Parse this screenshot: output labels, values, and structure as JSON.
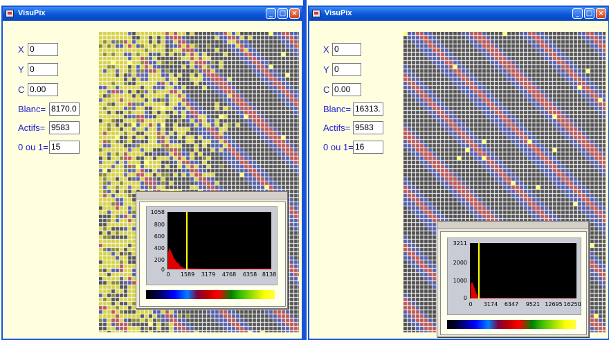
{
  "windows": [
    {
      "title": "VisuPix",
      "fields": [
        {
          "label": "X",
          "value": "0"
        },
        {
          "label": "Y",
          "value": "0"
        },
        {
          "label": "C",
          "value": "0.00"
        },
        {
          "label": "Blanc=",
          "value": "8170.0"
        },
        {
          "label": "Actifs=",
          "value": "9583"
        },
        {
          "label": "0 ou 1=",
          "value": "15"
        }
      ],
      "histogram": {
        "y_ticks": [
          "1058",
          "800",
          "600",
          "400",
          "200",
          "0"
        ],
        "x_ticks": [
          "0",
          "1589",
          "3179",
          "4768",
          "6358",
          "8138"
        ]
      }
    },
    {
      "title": "VisuPix",
      "fields": [
        {
          "label": "X",
          "value": "0"
        },
        {
          "label": "Y",
          "value": "0"
        },
        {
          "label": "C",
          "value": "0.00"
        },
        {
          "label": "Blanc=",
          "value": "16313."
        },
        {
          "label": "Actifs=",
          "value": "9583"
        },
        {
          "label": "0 ou 1=",
          "value": "16"
        }
      ],
      "histogram": {
        "y_ticks": [
          "3211",
          "2000",
          "1000",
          "0"
        ],
        "x_ticks": [
          "0",
          "3174",
          "6347",
          "9521",
          "12695",
          "16250"
        ]
      }
    }
  ],
  "colors": {
    "title_bar": "#0a55d8",
    "label_text": "#1d1dd6",
    "window_bg": "#ffffe0",
    "marker": "#ffff00"
  },
  "icons": [
    "visupix-app-icon",
    "minimize-icon",
    "maximize-icon",
    "close-icon"
  ]
}
